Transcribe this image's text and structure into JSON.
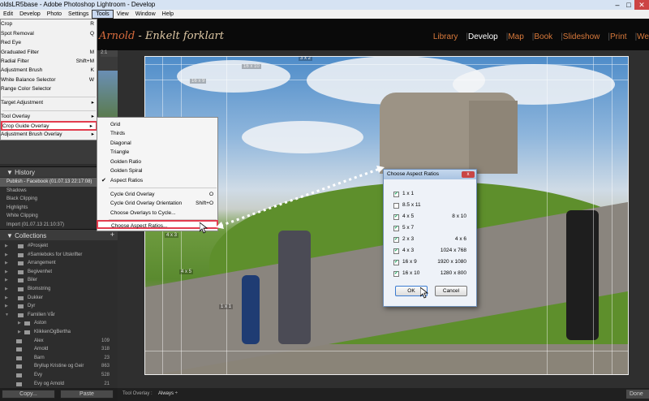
{
  "window": {
    "title": "oldsLR5base - Adobe Photoshop Lightroom - Develop"
  },
  "menubar": [
    "Edit",
    "Develop",
    "Photo",
    "Settings",
    "Tools",
    "View",
    "Window",
    "Help"
  ],
  "identity": {
    "plate_highlight": "Arnold",
    "plate_rest": " - Enkelt forklart"
  },
  "modules": [
    "Library",
    "Develop",
    "Map",
    "Book",
    "Slideshow",
    "Print",
    "We"
  ],
  "navigator": {
    "zoom": "2:1"
  },
  "tools_menu": {
    "items": [
      {
        "label": "Crop",
        "shortcut": "R"
      },
      {
        "label": "Spot Removal",
        "shortcut": "Q"
      },
      {
        "label": "Red Eye",
        "shortcut": ""
      },
      {
        "label": "Graduated Filter",
        "shortcut": "M"
      },
      {
        "label": "Radial Filter",
        "shortcut": "Shift+M"
      },
      {
        "label": "Adjustment Brush",
        "shortcut": "K"
      },
      {
        "label": "White Balance Selector",
        "shortcut": "W"
      },
      {
        "label": "Range Color Selector",
        "shortcut": ""
      },
      {
        "label": "Target Adjustment",
        "shortcut": "▸"
      },
      {
        "label": "Tool Overlay",
        "shortcut": "▸"
      },
      {
        "label": "Crop Guide Overlay",
        "shortcut": "▸"
      },
      {
        "label": "Adjustment Brush Overlay",
        "shortcut": "▸"
      }
    ]
  },
  "crop_guide_submenu": {
    "items": [
      {
        "label": "Grid",
        "shortcut": "",
        "checked": false
      },
      {
        "label": "Thirds",
        "shortcut": "",
        "checked": false
      },
      {
        "label": "Diagonal",
        "shortcut": "",
        "checked": false
      },
      {
        "label": "Triangle",
        "shortcut": "",
        "checked": false
      },
      {
        "label": "Golden Ratio",
        "shortcut": "",
        "checked": false
      },
      {
        "label": "Golden Spiral",
        "shortcut": "",
        "checked": false
      },
      {
        "label": "Aspect Ratios",
        "shortcut": "",
        "checked": true
      },
      {
        "label": "Cycle Grid Overlay",
        "shortcut": "O",
        "checked": false
      },
      {
        "label": "Cycle Grid Overlay Orientation",
        "shortcut": "Shift+O",
        "checked": false
      },
      {
        "label": "Choose Overlays to Cycle...",
        "shortcut": "",
        "checked": false
      },
      {
        "label": "Choose Aspect Ratios...",
        "shortcut": "",
        "checked": false
      }
    ],
    "check_mark": "✔"
  },
  "history": {
    "title": "History",
    "items": [
      "Publish - Facebook (01.07.13 22:17:08)",
      "Shadows",
      "Black Clipping",
      "Highlights",
      "White Clipping",
      "Import (01.07.13 21:10:37)"
    ]
  },
  "collections": {
    "title": "Collections",
    "plus": "+",
    "items": [
      {
        "label": "#Prosjekt",
        "count": ""
      },
      {
        "label": "#Samleboks for Utskrifter",
        "count": ""
      },
      {
        "label": "Arrangement",
        "count": ""
      },
      {
        "label": "Begivenhet",
        "count": ""
      },
      {
        "label": "Biler",
        "count": ""
      },
      {
        "label": "Blomstring",
        "count": ""
      },
      {
        "label": "Dukker",
        "count": ""
      },
      {
        "label": "Dyr",
        "count": ""
      },
      {
        "label": "Familien Vår",
        "count": ""
      },
      {
        "label": "Aston",
        "count": ""
      },
      {
        "label": "KlikkenOgBertha",
        "count": ""
      },
      {
        "label": "Alex",
        "count": "109"
      },
      {
        "label": "Arnold",
        "count": "318"
      },
      {
        "label": "Barn",
        "count": "23"
      },
      {
        "label": "Bryllup Kristine og Geir",
        "count": "863"
      },
      {
        "label": "Evy",
        "count": "528"
      },
      {
        "label": "Evy og Arnold",
        "count": "21"
      }
    ]
  },
  "left_buttons": {
    "copy": "Copy...",
    "paste": "Paste"
  },
  "bottom_bar": {
    "tool_overlay_label": "Tool Overlay :",
    "tool_overlay_value": "Always ÷",
    "done": "Done"
  },
  "ratio_labels": [
    "3 x 2",
    "16 x 10",
    "16 x 9",
    "4 x 3",
    "4 x 5",
    "1 x 1"
  ],
  "dialog": {
    "title": "Choose Aspect Ratios",
    "close": "x",
    "rows": [
      {
        "left": "1 x 1",
        "right": "",
        "checked": true
      },
      {
        "left": "8.5 x 11",
        "right": "",
        "checked": false
      },
      {
        "left": "4 x 5",
        "right": "8 x 10",
        "checked": true
      },
      {
        "left": "5 x 7",
        "right": "",
        "checked": true
      },
      {
        "left": "2 x 3",
        "right": "4 x 6",
        "checked": true
      },
      {
        "left": "4 x 3",
        "right": "1024 x 768",
        "checked": true
      },
      {
        "left": "16 x 9",
        "right": "1920 x 1080",
        "checked": true
      },
      {
        "left": "16 x 10",
        "right": "1280 x 800",
        "checked": true
      }
    ],
    "ok": "OK",
    "cancel": "Cancel",
    "check_mark": "✔"
  },
  "colors": {
    "accent_red": "#e23d4f",
    "module_orange": "#d97a3c"
  }
}
